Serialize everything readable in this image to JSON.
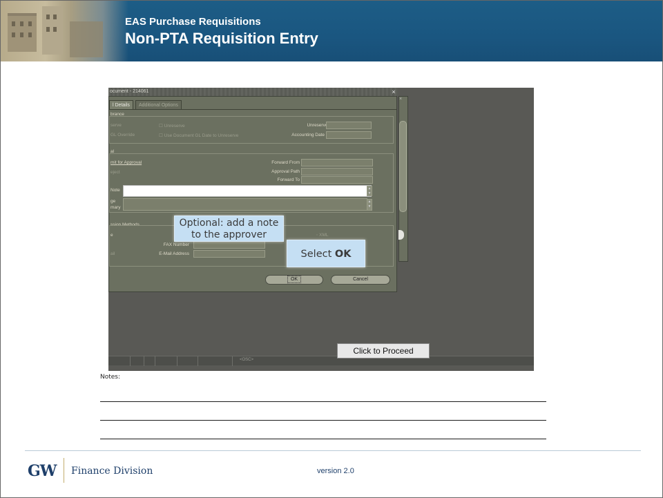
{
  "header": {
    "title_line1": "EAS Purchase Requisitions",
    "title_line2": "Non-PTA Requisition Entry"
  },
  "oracle_window": {
    "title": "ocument - 214061",
    "close_glyph": "×",
    "right_window_close_glyph": "×",
    "tabs": [
      {
        "label": "l Details",
        "active": true
      },
      {
        "label": "Additional Options",
        "active": false
      }
    ],
    "encumbrance": {
      "section_label": "brance",
      "reserve_label": "serve",
      "gl_override_label": "GL Override",
      "unreserve_checkbox_label": "Unreserve",
      "use_document_gl_label": "Use Document GL Date to Unreserve",
      "unreserve_date_label": "Unreserve Date",
      "accounting_date_label": "Accounting Date"
    },
    "approval": {
      "section_label": "al",
      "submit_for_approval_label": "mit for Approval",
      "reject_label": "eject",
      "forward_from_label": "Forward From",
      "approval_path_label": "Approval Path",
      "forward_to_label": "Forward To",
      "note_label": "Note",
      "note_value": "",
      "message_label": "ge",
      "summary_label": "mary"
    },
    "transmission": {
      "section_label": "ssion Methods",
      "e_label": "e",
      "xml_label": "XML",
      "fax_number_label": "FAX Number",
      "email_row_label": "ail",
      "email_address_label": "E-Mail Address"
    },
    "ok_button": "OK",
    "cancel_button": "Cancel",
    "status_bar_text": "<OSC>"
  },
  "callouts": {
    "note_line1": "Optional: add a note",
    "note_line2": "to the approver",
    "ok_prefix": "Select ",
    "ok_bold": "OK"
  },
  "proceed_button": "Click to Proceed",
  "notes_label": "Notes:",
  "footer": {
    "logo_text": "GW",
    "division": "Finance Division",
    "version": "version 2.0"
  },
  "colors": {
    "header_blue": "#1d5d86",
    "callout_fill": "#c5dff3",
    "footer_navy": "#1e3f6a"
  }
}
